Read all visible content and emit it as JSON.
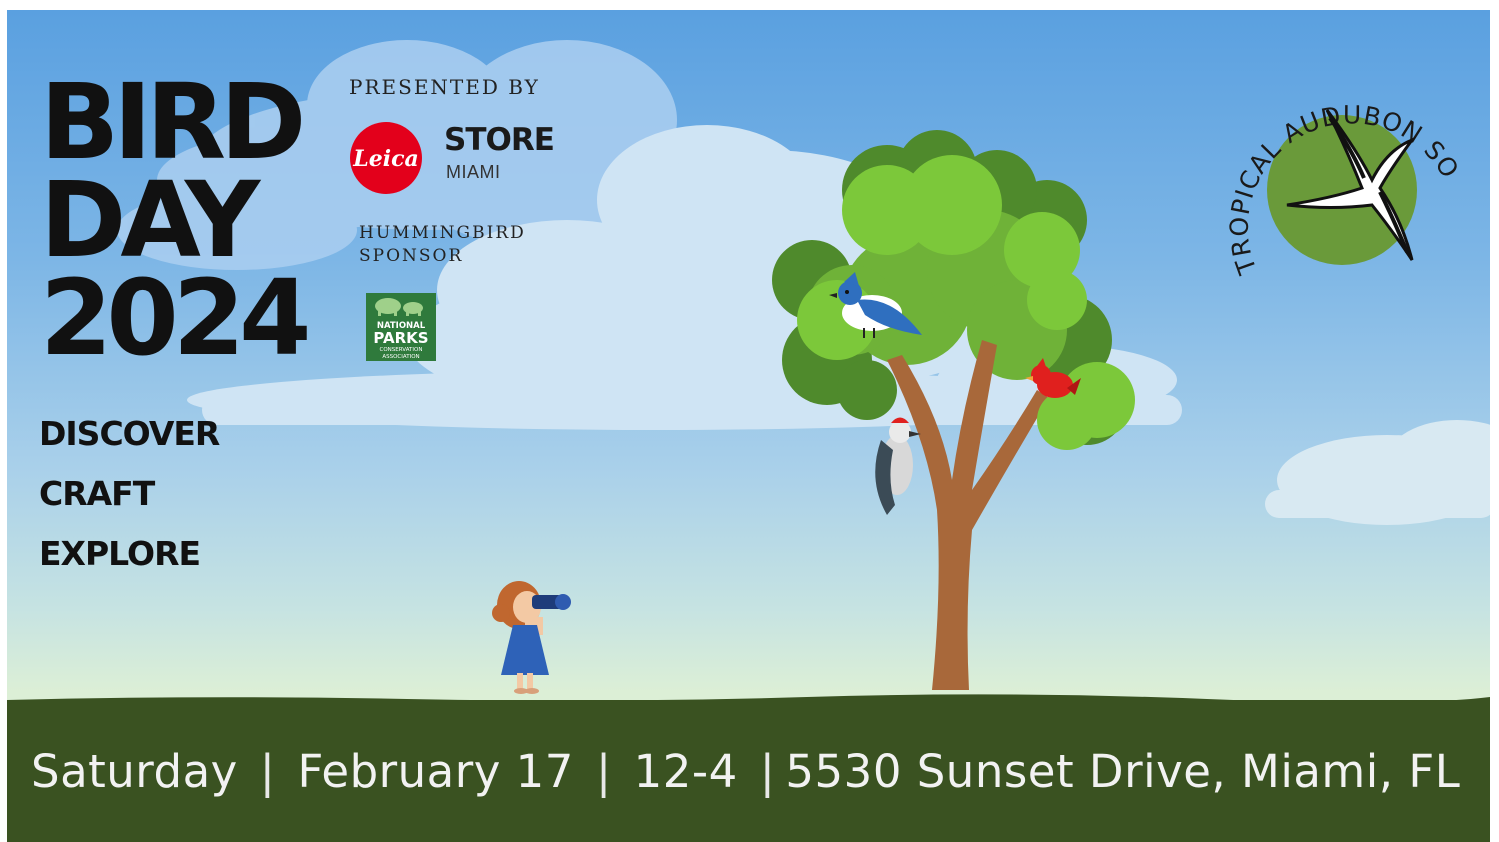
{
  "title": {
    "line1": "BIRD",
    "line2": "DAY",
    "line3": "2024"
  },
  "activities": [
    "DISCOVER",
    "CRAFT",
    "EXPLORE"
  ],
  "presenter": {
    "label": "PRESENTED BY",
    "logo_text": "Leica",
    "store": "STORE",
    "store_city": "MIAMI"
  },
  "sponsor": {
    "label_line1": "HUMMINGBIRD",
    "label_line2": "SPONSOR",
    "logo_lines": [
      "NATIONAL",
      "PARKS",
      "CONSERVATION",
      "ASSOCIATION"
    ]
  },
  "org_seal": {
    "text": "TROPICAL AUDUBON SOCIETY"
  },
  "event": {
    "day": "Saturday",
    "date": "February 17",
    "time": "12-4",
    "address": "5530 Sunset Drive, Miami, FL"
  },
  "colors": {
    "sky_top": "#5aa0e0",
    "ground": "#3a5221",
    "leica_red": "#e3001b",
    "npca_green": "#2f7a3c",
    "seal_green": "#6a9a3a",
    "tree_light": "#7cc83a",
    "tree_dark": "#4f8a2c",
    "trunk": "#a8683a"
  },
  "icons": [
    "blue-jay-icon",
    "cardinal-icon",
    "woodpecker-icon",
    "swallow-tailed-kite-icon",
    "bison-icon"
  ]
}
